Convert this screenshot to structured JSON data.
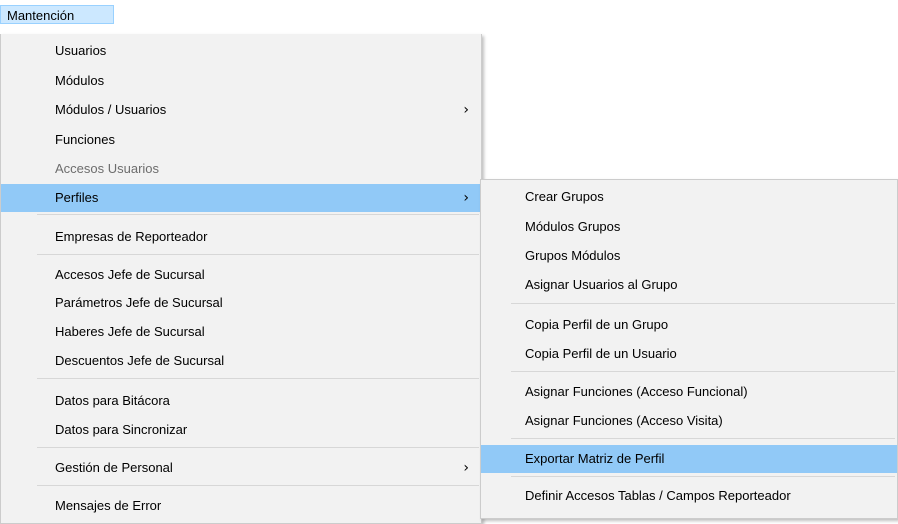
{
  "menubar": {
    "title": "Mantención"
  },
  "main_menu": {
    "items": [
      {
        "label": "Usuarios"
      },
      {
        "label": "Módulos"
      },
      {
        "label": "Módulos / Usuarios",
        "arrow": "›"
      },
      {
        "label": "Funciones"
      },
      {
        "label": "Accesos Usuarios",
        "disabled": true
      },
      {
        "label": "Perfiles",
        "arrow": "›",
        "highlighted": true
      },
      {
        "label": "Empresas de Reporteador"
      },
      {
        "label": "Accesos Jefe de Sucursal"
      },
      {
        "label": "Parámetros Jefe de Sucursal"
      },
      {
        "label": "Haberes Jefe de Sucursal"
      },
      {
        "label": "Descuentos Jefe de Sucursal"
      },
      {
        "label": "Datos para Bitácora"
      },
      {
        "label": "Datos para Sincronizar"
      },
      {
        "label": "Gestión de Personal",
        "arrow": "›"
      },
      {
        "label": "Mensajes de Error"
      }
    ]
  },
  "sub_menu": {
    "items": [
      {
        "label": "Crear Grupos"
      },
      {
        "label": "Módulos Grupos"
      },
      {
        "label": "Grupos Módulos"
      },
      {
        "label": "Asignar Usuarios al Grupo"
      },
      {
        "label": "Copia Perfil de un Grupo"
      },
      {
        "label": "Copia Perfil de un Usuario"
      },
      {
        "label": "Asignar Funciones (Acceso Funcional)"
      },
      {
        "label": "Asignar Funciones (Acceso Visita)"
      },
      {
        "label": "Exportar Matriz de Perfil",
        "highlighted": true
      },
      {
        "label": "Definir Accesos Tablas / Campos Reporteador"
      }
    ]
  },
  "colors": {
    "menu_background": "#f2f2f2",
    "highlight": "#91c9f7",
    "menubar_selected": "#cce8ff",
    "disabled_text": "#6d6d6d"
  }
}
